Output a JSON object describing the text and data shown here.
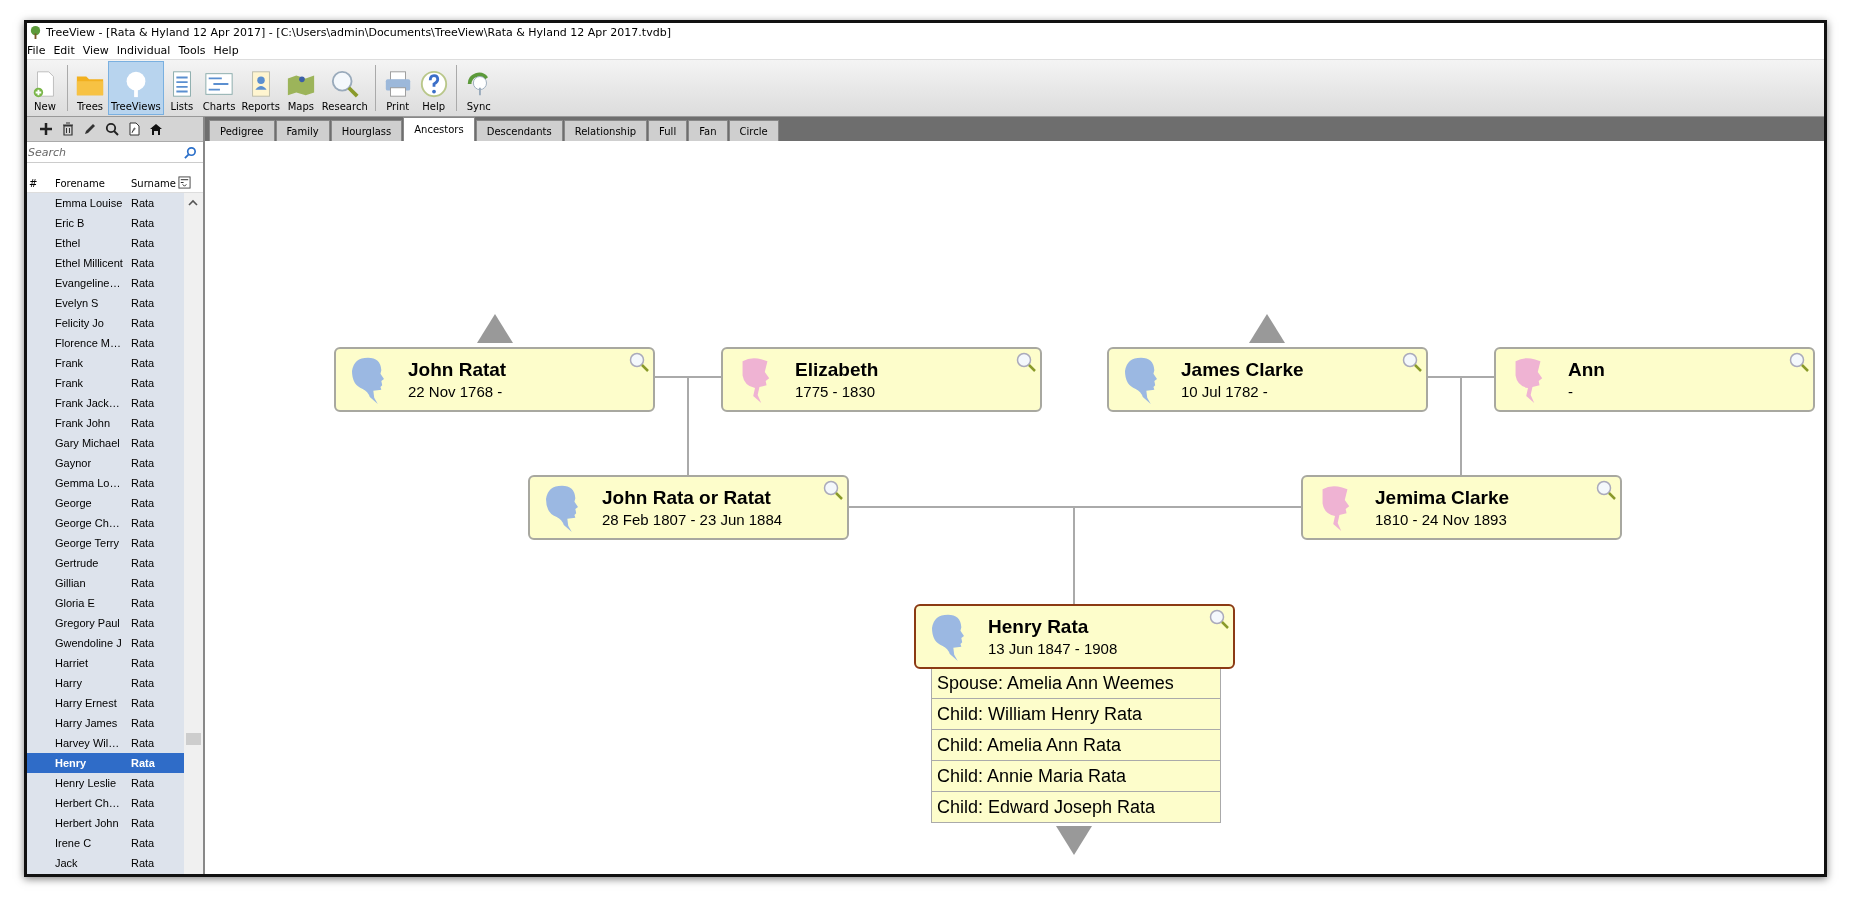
{
  "window": {
    "title": "TreeView - [Rata & Hyland 12 Apr 2017] - [C:\\Users\\admin\\Documents\\TreeView\\Rata & Hyland 12 Apr 2017.tvdb]"
  },
  "menu": [
    "File",
    "Edit",
    "View",
    "Individual",
    "Tools",
    "Help"
  ],
  "toolbar": [
    {
      "label": "New",
      "selected": false
    },
    {
      "label": "Trees",
      "selected": false
    },
    {
      "label": "TreeViews",
      "selected": true
    },
    {
      "label": "Lists",
      "selected": false
    },
    {
      "label": "Charts",
      "selected": false
    },
    {
      "label": "Reports",
      "selected": false
    },
    {
      "label": "Maps",
      "selected": false
    },
    {
      "label": "Research",
      "selected": false
    },
    {
      "label": "Print",
      "selected": false
    },
    {
      "label": "Help",
      "selected": false
    },
    {
      "label": "Sync",
      "selected": false
    }
  ],
  "sidebar": {
    "search": {
      "placeholder": "Search"
    },
    "columns": [
      "#",
      "Forename",
      "Surname"
    ],
    "rows": [
      {
        "forename": "Emma Louise",
        "surname": "Rata",
        "selected": false
      },
      {
        "forename": "Eric B",
        "surname": "Rata",
        "selected": false
      },
      {
        "forename": "Ethel",
        "surname": "Rata",
        "selected": false
      },
      {
        "forename": "Ethel Millicent",
        "surname": "Rata",
        "selected": false
      },
      {
        "forename": "Evangeline…",
        "surname": "Rata",
        "selected": false
      },
      {
        "forename": "Evelyn S",
        "surname": "Rata",
        "selected": false
      },
      {
        "forename": "Felicity Jo",
        "surname": "Rata",
        "selected": false
      },
      {
        "forename": "Florence M…",
        "surname": "Rata",
        "selected": false
      },
      {
        "forename": "Frank",
        "surname": "Rata",
        "selected": false
      },
      {
        "forename": "Frank",
        "surname": "Rata",
        "selected": false
      },
      {
        "forename": "Frank Jack…",
        "surname": "Rata",
        "selected": false
      },
      {
        "forename": "Frank John",
        "surname": "Rata",
        "selected": false
      },
      {
        "forename": "Gary Michael",
        "surname": "Rata",
        "selected": false
      },
      {
        "forename": "Gaynor",
        "surname": "Rata",
        "selected": false
      },
      {
        "forename": "Gemma Lo…",
        "surname": "Rata",
        "selected": false
      },
      {
        "forename": "George",
        "surname": "Rata",
        "selected": false
      },
      {
        "forename": "George Ch…",
        "surname": "Rata",
        "selected": false
      },
      {
        "forename": "George Terry",
        "surname": "Rata",
        "selected": false
      },
      {
        "forename": "Gertrude",
        "surname": "Rata",
        "selected": false
      },
      {
        "forename": "Gillian",
        "surname": "Rata",
        "selected": false
      },
      {
        "forename": "Gloria E",
        "surname": "Rata",
        "selected": false
      },
      {
        "forename": "Gregory Paul",
        "surname": "Rata",
        "selected": false
      },
      {
        "forename": "Gwendoline J",
        "surname": "Rata",
        "selected": false
      },
      {
        "forename": "Harriet",
        "surname": "Rata",
        "selected": false
      },
      {
        "forename": "Harry",
        "surname": "Rata",
        "selected": false
      },
      {
        "forename": "Harry Ernest",
        "surname": "Rata",
        "selected": false
      },
      {
        "forename": "Harry James",
        "surname": "Rata",
        "selected": false
      },
      {
        "forename": "Harvey Wil…",
        "surname": "Rata",
        "selected": false
      },
      {
        "forename": "Henry",
        "surname": "Rata",
        "selected": true
      },
      {
        "forename": "Henry Leslie",
        "surname": "Rata",
        "selected": false
      },
      {
        "forename": "Herbert Ch…",
        "surname": "Rata",
        "selected": false
      },
      {
        "forename": "Herbert John",
        "surname": "Rata",
        "selected": false
      },
      {
        "forename": "Irene C",
        "surname": "Rata",
        "selected": false
      },
      {
        "forename": "Jack",
        "surname": "Rata",
        "selected": false
      }
    ]
  },
  "tabs": [
    {
      "label": "Pedigree",
      "selected": false
    },
    {
      "label": "Family",
      "selected": false
    },
    {
      "label": "Hourglass",
      "selected": false
    },
    {
      "label": "Ancestors",
      "selected": true
    },
    {
      "label": "Descendants",
      "selected": false
    },
    {
      "label": "Relationship",
      "selected": false
    },
    {
      "label": "Full",
      "selected": false
    },
    {
      "label": "Fan",
      "selected": false
    },
    {
      "label": "Circle",
      "selected": false
    }
  ],
  "tree": {
    "grandparents": [
      {
        "name": "John Ratat",
        "dates": "22 Nov 1768 -",
        "kind": "male",
        "selected": false
      },
      {
        "name": "Elizabeth",
        "dates": "1775 - 1830",
        "kind": "female",
        "selected": false
      },
      {
        "name": "James Clarke",
        "dates": "10 Jul 1782 -",
        "kind": "male",
        "selected": false
      },
      {
        "name": "Ann",
        "dates": "-",
        "kind": "female",
        "selected": false
      }
    ],
    "parents": [
      {
        "name": "John Rata or Ratat",
        "dates": "28 Feb 1807 - 23 Jun 1884",
        "kind": "male",
        "selected": false
      },
      {
        "name": "Jemima Clarke",
        "dates": "1810 - 24 Nov 1893",
        "kind": "female",
        "selected": false
      }
    ],
    "person": {
      "name": "Henry Rata",
      "dates": "13 Jun 1847 - 1908",
      "kind": "male",
      "selected": true
    },
    "family": [
      "Spouse: Amelia Ann Weemes",
      "Child: William Henry Rata",
      "Child: Amelia Ann Rata",
      "Child: Annie Maria Rata",
      "Child: Edward Joseph Rata"
    ]
  }
}
